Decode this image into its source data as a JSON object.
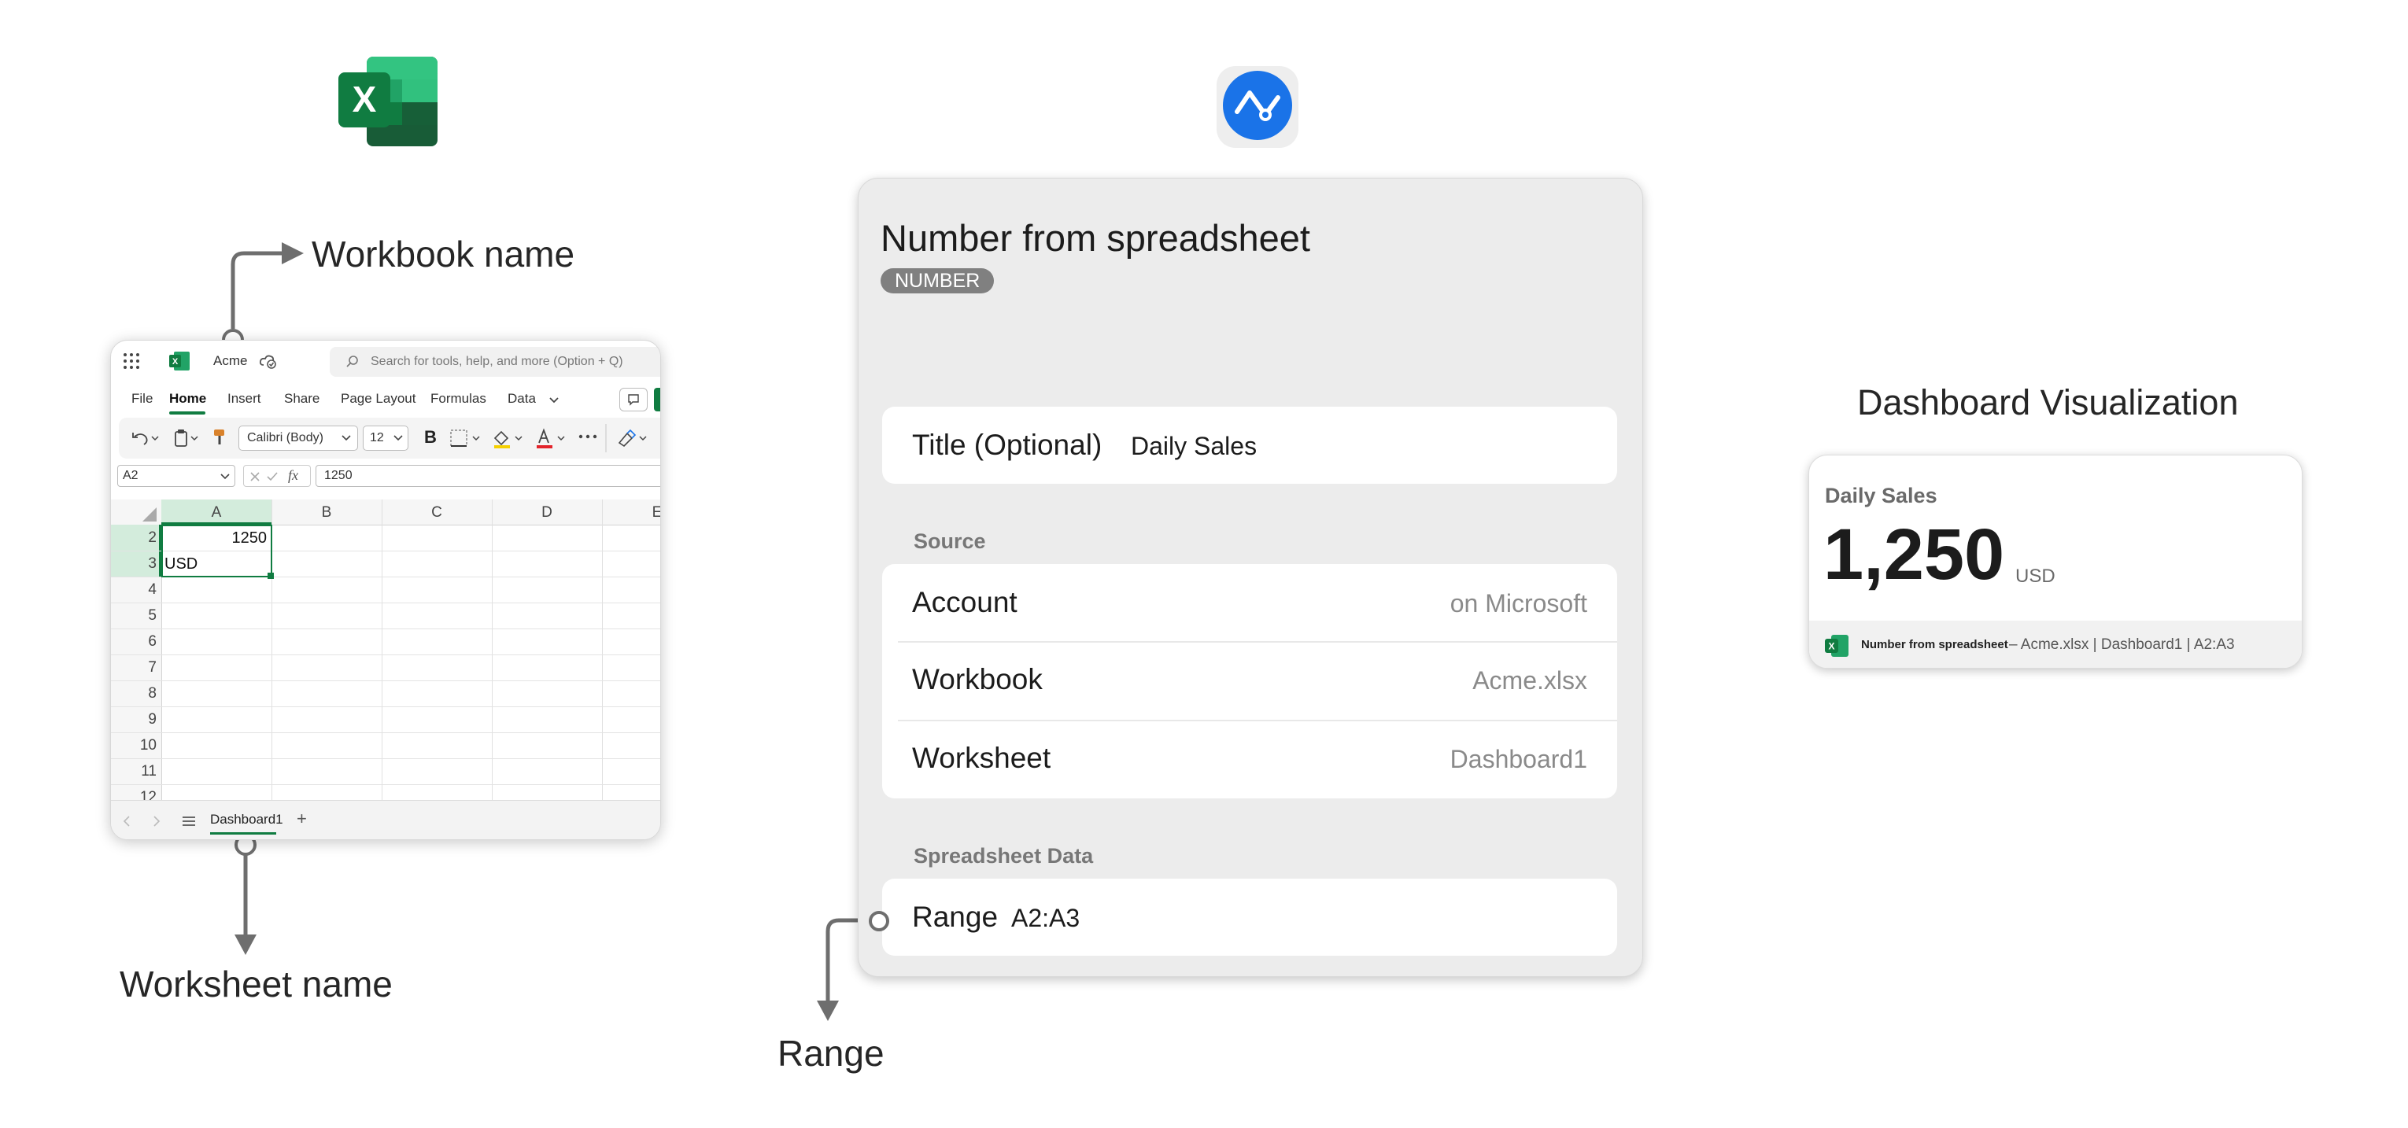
{
  "excel": {
    "workbook_title": "Acme",
    "search_placeholder": "Search for tools, help, and more (Option + Q)",
    "tabs": [
      "File",
      "Home",
      "Insert",
      "Share",
      "Page Layout",
      "Formulas",
      "Data"
    ],
    "font_name": "Calibri (Body)",
    "font_size": "12",
    "bold_label": "B",
    "name_box": "A2",
    "formula_value": "1250",
    "columns": [
      "A",
      "B",
      "C",
      "D",
      "E"
    ],
    "rows": [
      "2",
      "3",
      "4",
      "5",
      "6",
      "7",
      "8",
      "9",
      "10",
      "11",
      "12"
    ],
    "cells": {
      "a2": "1250",
      "a3": "USD"
    },
    "sheet_tab": "Dashboard1",
    "add_sheet": "+",
    "accent": "#107c41"
  },
  "annotations": {
    "workbook_name": "Workbook name",
    "worksheet_name": "Worksheet name",
    "range": "Range",
    "dashboard_visualization": "Dashboard Visualization"
  },
  "panel": {
    "title": "Number from spreadsheet",
    "badge": "NUMBER",
    "title_field_label": "Title (Optional)",
    "title_field_value": "Daily Sales",
    "source_header": "Source",
    "account_label": "Account",
    "account_value": "on Microsoft",
    "workbook_label": "Workbook",
    "workbook_value": "Acme.xlsx",
    "worksheet_label": "Worksheet",
    "worksheet_value": "Dashboard1",
    "spreadsheet_header": "Spreadsheet Data",
    "range_label": "Range",
    "range_value": "A2:A3",
    "app_icon_color": "#1a73e8"
  },
  "dashboard": {
    "title": "Daily Sales",
    "value": "1,250",
    "unit": "USD",
    "footer_name": "Number from spreadsheet",
    "footer_detail": "– Acme.xlsx | Dashboard1 | A2:A3"
  }
}
